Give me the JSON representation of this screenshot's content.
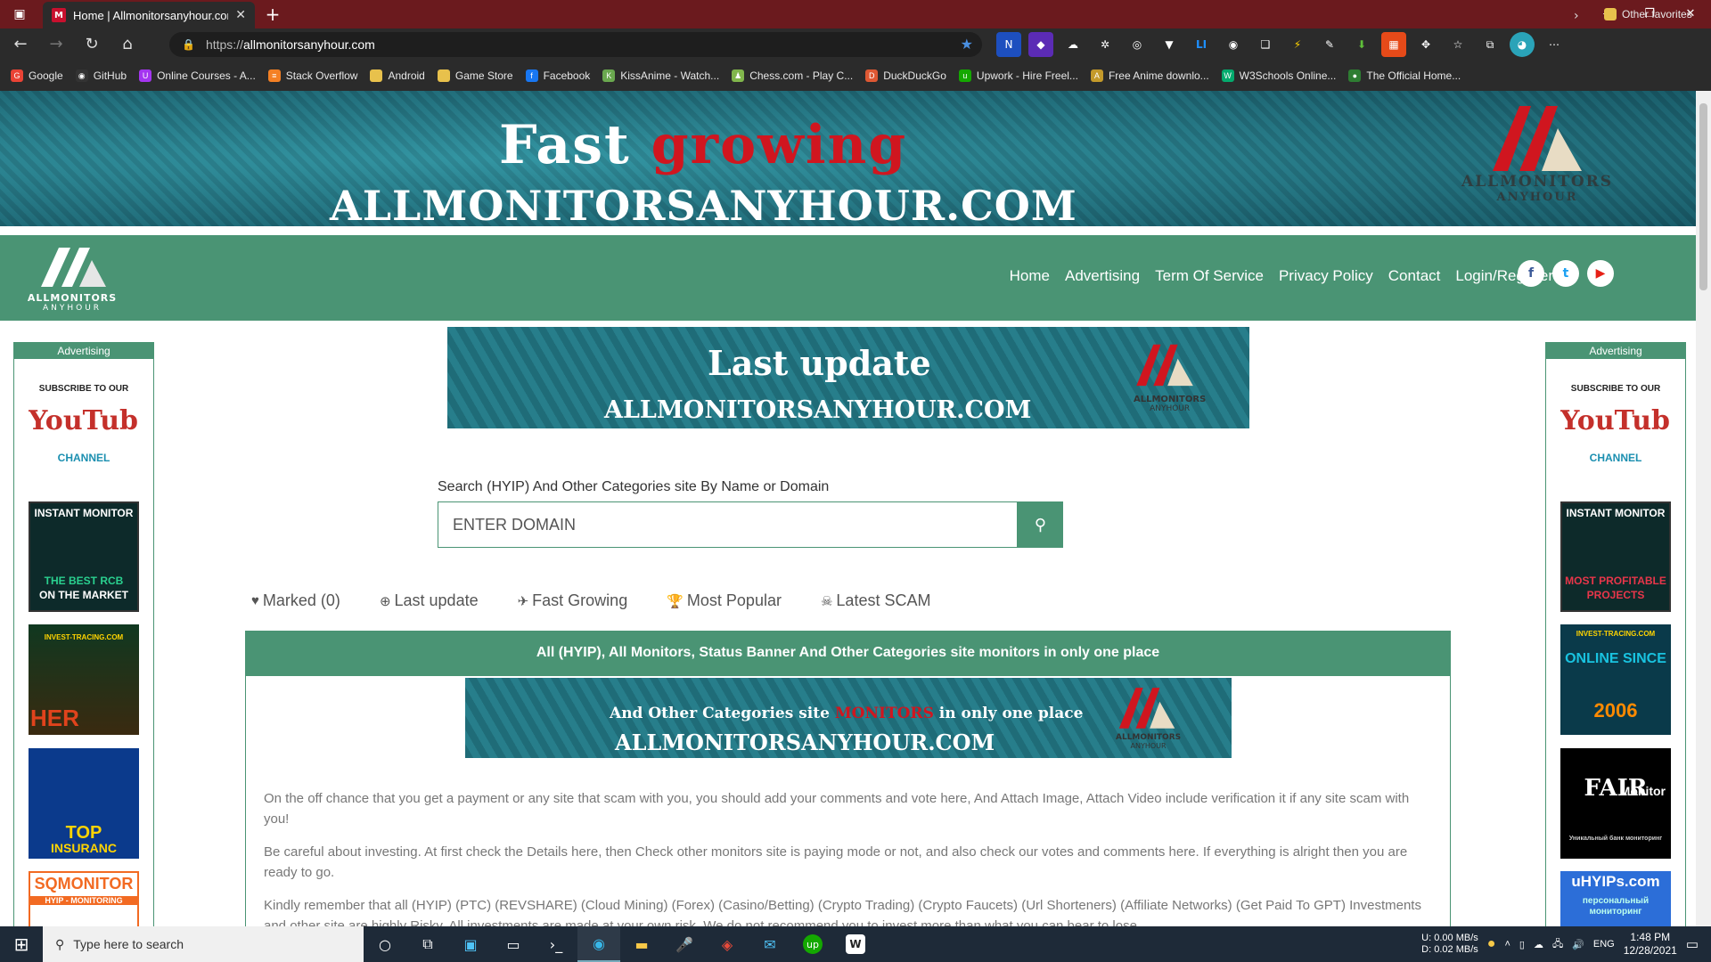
{
  "browser": {
    "tab_title": "Home | Allmonitorsanyhour.com",
    "tab_close": "✕",
    "new_tab": "+",
    "url_prefix": "https://",
    "url_domain": "allmonitorsanyhour.com",
    "window_controls": [
      "—",
      "❐",
      "✕"
    ],
    "bookmarks": [
      {
        "label": "Google",
        "color": "#ea4335",
        "glyph": "G"
      },
      {
        "label": "GitHub",
        "color": "#333333",
        "glyph": "◉"
      },
      {
        "label": "Online Courses - A...",
        "color": "#a435f0",
        "glyph": "U"
      },
      {
        "label": "Stack Overflow",
        "color": "#f48024",
        "glyph": "≡"
      },
      {
        "label": "Android",
        "color": "#e8c14c",
        "glyph": ""
      },
      {
        "label": "Game Store",
        "color": "#e8c14c",
        "glyph": ""
      },
      {
        "label": "Facebook",
        "color": "#1877f2",
        "glyph": "f"
      },
      {
        "label": "KissAnime - Watch...",
        "color": "#6aa84f",
        "glyph": "K"
      },
      {
        "label": "Chess.com - Play C...",
        "color": "#81b64c",
        "glyph": "♟"
      },
      {
        "label": "DuckDuckGo",
        "color": "#de5833",
        "glyph": "D"
      },
      {
        "label": "Upwork - Hire Freel...",
        "color": "#14a800",
        "glyph": "u"
      },
      {
        "label": "Free Anime downlo...",
        "color": "#c49a2a",
        "glyph": "A"
      },
      {
        "label": "W3Schools Online...",
        "color": "#04aa6d",
        "glyph": "W"
      },
      {
        "label": "The Official Home...",
        "color": "#2e7d32",
        "glyph": "●"
      }
    ],
    "other_favorites": "Other favorites"
  },
  "hero": {
    "line1a": "Fast",
    "line1b": "growing",
    "line2": "ALLMONITORSANYHOUR.COM",
    "logo_text": "ALLMONITORS",
    "logo_sub": "ANYHOUR"
  },
  "nav": {
    "brand_line1": "ALLMONITORS",
    "brand_line2": "ANYHOUR",
    "items": [
      "Home",
      "Advertising",
      "Term Of Service",
      "Privacy Policy",
      "Contact",
      "Login/Register"
    ],
    "social": [
      "f",
      "t",
      "▶"
    ]
  },
  "side_ads": {
    "header": "Advertising",
    "left": [
      {
        "top": "SUBSCRIBE TO OUR",
        "main": "YouTube",
        "sub": "CHANNEL"
      },
      {
        "top": "INSTANT MONITOR",
        "main": "THE BEST RCB",
        "sub": "ON THE MARKET"
      },
      {
        "top": "INVEST-TRACING.COM",
        "main": "HER",
        "sub": ""
      },
      {
        "top": "",
        "main": "TOP",
        "sub": "INSURANC"
      },
      {
        "top": "SQMONITOR",
        "main": "HYIP - MONITORING",
        "sub": ""
      }
    ],
    "right": [
      {
        "top": "SUBSCRIBE TO OUR",
        "main": "YouTube",
        "sub": "CHANNEL"
      },
      {
        "top": "INSTANT MONITOR",
        "main": "MOST PROFITABLE",
        "sub": "PROJECTS"
      },
      {
        "top": "INVEST-TRACING.COM",
        "main": "ONLINE SINCE",
        "sub": "2006"
      },
      {
        "top": "FAIR",
        "main": "Monitor",
        "sub": "Уникальный банк мониторинг"
      },
      {
        "top": "uHYIPs.com",
        "main": "персональный",
        "sub": "мониторинг"
      }
    ]
  },
  "last_update_banner": {
    "line1": "Last update",
    "line2": "ALLMONITORSANYHOUR.COM",
    "logo_text": "ALLMONITORS",
    "logo_sub": "ANYHOUR"
  },
  "search": {
    "label": "Search (HYIP) And Other Categories site By Name or Domain",
    "placeholder": "ENTER DOMAIN"
  },
  "tabs": [
    {
      "icon": "♥",
      "label": "Marked (0)"
    },
    {
      "icon": "⊕",
      "label": "Last update"
    },
    {
      "icon": "✈",
      "label": "Fast Growing"
    },
    {
      "icon": "🏆",
      "label": "Most Popular"
    },
    {
      "icon": "☠",
      "label": "Latest SCAM"
    }
  ],
  "panel": {
    "header": "All (HYIP), All Monitors, Status Banner And Other Categories site monitors in only one place",
    "banner_line1a": "And Other Categories site",
    "banner_line1b": "MONITORS",
    "banner_line1c": "in only one place",
    "banner_line2": "ALLMONITORSANYHOUR.COM",
    "banner_logo": "ALLMONITORS",
    "banner_logo_sub": "ANYHOUR",
    "paragraphs": [
      "On the off chance that you get a payment or any site that scam with you, you should add your comments and vote here, And Attach Image, Attach Video include verification it if any site scam with you!",
      "Be careful about investing. At first check the Details here, then Check other monitors site is paying mode or not, and also check our votes and comments here. If everything is alright then you are ready to go.",
      "Kindly remember that all (HYIP) (PTC) (REVSHARE) (Cloud Mining) (Forex) (Casino/Betting) (Crypto Trading) (Crypto Faucets) (Url Shorteners) (Affiliate Networks) (Get Paid To GPT) Investments and other site are highly Risky. All investments are made at your own risk. We do not recommend you to invest more than what you can bear to lose."
    ]
  },
  "taskbar": {
    "search_placeholder": "Type here to search",
    "net_up": "0.00 MB/s",
    "net_down": "0.02 MB/s",
    "net_up_label": "U:",
    "net_down_label": "D:",
    "lang": "ENG",
    "time": "1:48 PM",
    "date": "12/28/2021"
  }
}
